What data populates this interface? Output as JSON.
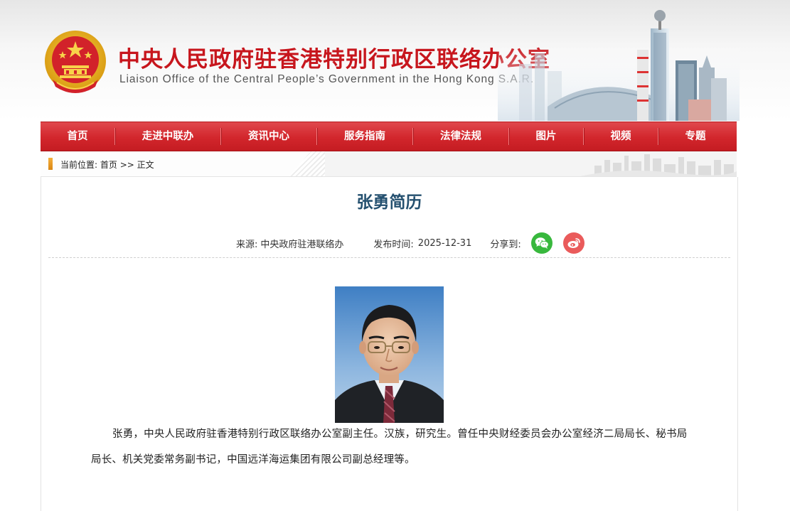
{
  "header": {
    "title_cn": "中央人民政府驻香港特别行政区联络办公室",
    "title_en": "Liaison Office of the Central People’s Government in the Hong Kong S.A.R."
  },
  "nav": {
    "items": [
      "首页",
      "走进中联办",
      "资讯中心",
      "服务指南",
      "法律法规",
      "图片",
      "视频",
      "专题"
    ]
  },
  "breadcrumb": {
    "prefix": "当前位置:",
    "home": "首页",
    "separator": ">>",
    "current": "正文"
  },
  "article": {
    "title": "张勇简历",
    "source_label": "来源:",
    "source": "中央政府驻港联络办",
    "date_label": "发布时间:",
    "date": "2025-12-31",
    "share_label": "分享到:",
    "body": "张勇，中央人民政府驻香港特别行政区联络办公室副主任。汉族，研究生。曾任中央财经委员会办公室经济二局局长、秘书局局长、机关党委常务副书记，中国远洋海运集团有限公司副总经理等。"
  },
  "colors": {
    "brand_red": "#c7161d",
    "nav_red": "#d2262c",
    "title_blue": "#24506f",
    "wechat_green": "#38b83d",
    "weibo_red": "#ea5b5b"
  },
  "icons": [
    "national-emblem-icon",
    "wechat-icon",
    "weibo-icon"
  ]
}
